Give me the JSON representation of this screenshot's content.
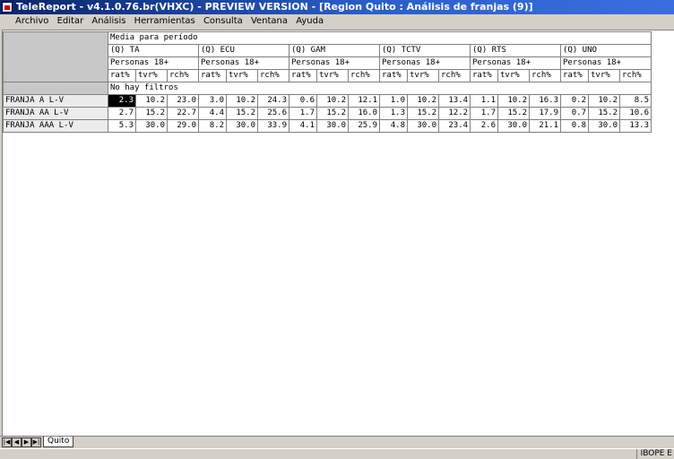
{
  "window": {
    "title": "TeleReport - v4.1.0.76.br(VHXC) - PREVIEW VERSION - [Region Quito : Análisis de franjas (9)]"
  },
  "menu": [
    "Archivo",
    "Editar",
    "Análisis",
    "Herramientas",
    "Consulta",
    "Ventana",
    "Ayuda"
  ],
  "report": {
    "header": "Media para período",
    "groups": [
      "(Q) TA",
      "(Q) ECU",
      "(Q) GAM",
      "(Q) TCTV",
      "(Q) RTS",
      "(Q) UNO"
    ],
    "target": "Personas 18+",
    "metrics": [
      "rat%",
      "tvr%",
      "rch%"
    ],
    "filter": "No hay filtros",
    "rows": [
      {
        "label": "FRANJA A L-V",
        "values": [
          "2.3",
          "10.2",
          "23.0",
          "3.0",
          "10.2",
          "24.3",
          "0.6",
          "10.2",
          "12.1",
          "1.0",
          "10.2",
          "13.4",
          "1.1",
          "10.2",
          "16.3",
          "0.2",
          "10.2",
          "8.5"
        ]
      },
      {
        "label": "FRANJA AA L-V",
        "values": [
          "2.7",
          "15.2",
          "22.7",
          "4.4",
          "15.2",
          "25.6",
          "1.7",
          "15.2",
          "16.0",
          "1.3",
          "15.2",
          "12.2",
          "1.7",
          "15.2",
          "17.9",
          "0.7",
          "15.2",
          "10.6"
        ]
      },
      {
        "label": "FRANJA AAA L-V",
        "values": [
          "5.3",
          "30.0",
          "29.0",
          "8.2",
          "30.0",
          "33.9",
          "4.1",
          "30.0",
          "25.9",
          "4.8",
          "30.0",
          "23.4",
          "2.6",
          "30.0",
          "21.1",
          "0.8",
          "30.0",
          "13.3"
        ]
      }
    ]
  },
  "sheet_tab": "Quito",
  "status": {
    "right": "IBOPE E"
  }
}
